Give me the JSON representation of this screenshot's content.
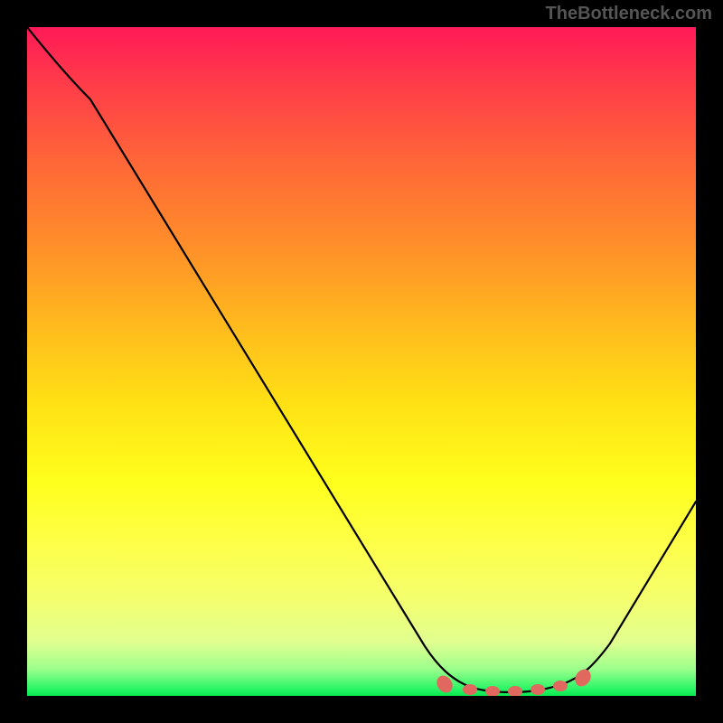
{
  "watermark": "TheBottleneck.com",
  "chart_data": {
    "type": "line",
    "title": "",
    "xlabel": "",
    "ylabel": "",
    "xlim": [
      0,
      100
    ],
    "ylim": [
      0,
      100
    ],
    "grid": false,
    "series": [
      {
        "name": "curve",
        "x": [
          0,
          5,
          10,
          15,
          20,
          25,
          30,
          35,
          40,
          45,
          50,
          55,
          60,
          62,
          65,
          68,
          71,
          74,
          77,
          80,
          83,
          85,
          88,
          92,
          96,
          100
        ],
        "y": [
          100,
          97,
          92.5,
          85,
          77,
          69,
          61,
          53,
          45,
          37,
          29,
          21,
          12,
          8,
          4.5,
          2.3,
          1.2,
          0.7,
          0.6,
          0.8,
          1.5,
          3,
          6,
          12,
          20,
          29
        ],
        "color": "#000000"
      }
    ],
    "markers": {
      "name": "highlight-dots",
      "x": [
        62,
        66,
        70,
        74,
        78,
        82,
        85
      ],
      "y": [
        1.3,
        1.0,
        0.9,
        0.9,
        1.0,
        1.2,
        1.6
      ],
      "color": "#e0685e",
      "size": 8
    },
    "background_gradient": {
      "top": "#ff1a58",
      "bottom": "#0ae850",
      "stops": [
        "#ff1a58",
        "#ff6638",
        "#ffb81e",
        "#ffff1c",
        "#f3ff70",
        "#28f565",
        "#0ae850"
      ]
    }
  }
}
